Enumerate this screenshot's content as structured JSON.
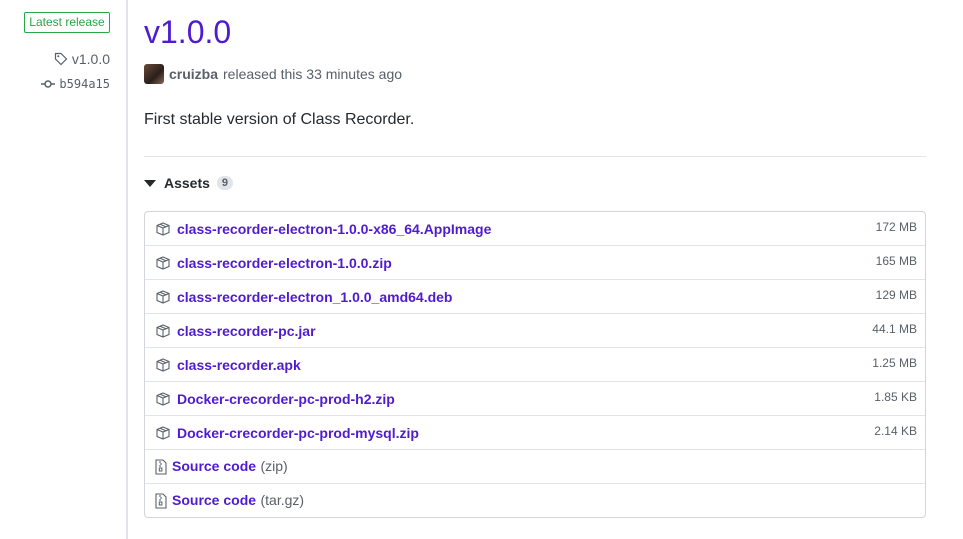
{
  "sidebar": {
    "badge": "Latest release",
    "tag": "v1.0.0",
    "commit": "b594a15"
  },
  "release": {
    "title": "v1.0.0",
    "author": "cruizba",
    "released_text": "released this 33 minutes ago",
    "description": "First stable version of Class Recorder."
  },
  "assets": {
    "label": "Assets",
    "count": "9",
    "files": [
      {
        "name": "class-recorder-electron-1.0.0-x86_64.AppImage",
        "size": "172 MB",
        "icon": "package-icon"
      },
      {
        "name": "class-recorder-electron-1.0.0.zip",
        "size": "165 MB",
        "icon": "package-icon"
      },
      {
        "name": "class-recorder-electron_1.0.0_amd64.deb",
        "size": "129 MB",
        "icon": "package-icon"
      },
      {
        "name": "class-recorder-pc.jar",
        "size": "44.1 MB",
        "icon": "package-icon"
      },
      {
        "name": "class-recorder.apk",
        "size": "1.25 MB",
        "icon": "package-icon"
      },
      {
        "name": "Docker-crecorder-pc-prod-h2.zip",
        "size": "1.85 KB",
        "icon": "package-icon"
      },
      {
        "name": "Docker-crecorder-pc-prod-mysql.zip",
        "size": "2.14 KB",
        "icon": "package-icon"
      }
    ],
    "source": [
      {
        "name": "Source code",
        "suffix": "(zip)",
        "icon": "file-zip-icon"
      },
      {
        "name": "Source code",
        "suffix": "(tar.gz)",
        "icon": "file-zip-icon"
      }
    ]
  },
  "colors": {
    "link": "#4f1bd1",
    "badge_green": "#28a745",
    "muted": "#586069",
    "border": "#e1e4e8"
  }
}
